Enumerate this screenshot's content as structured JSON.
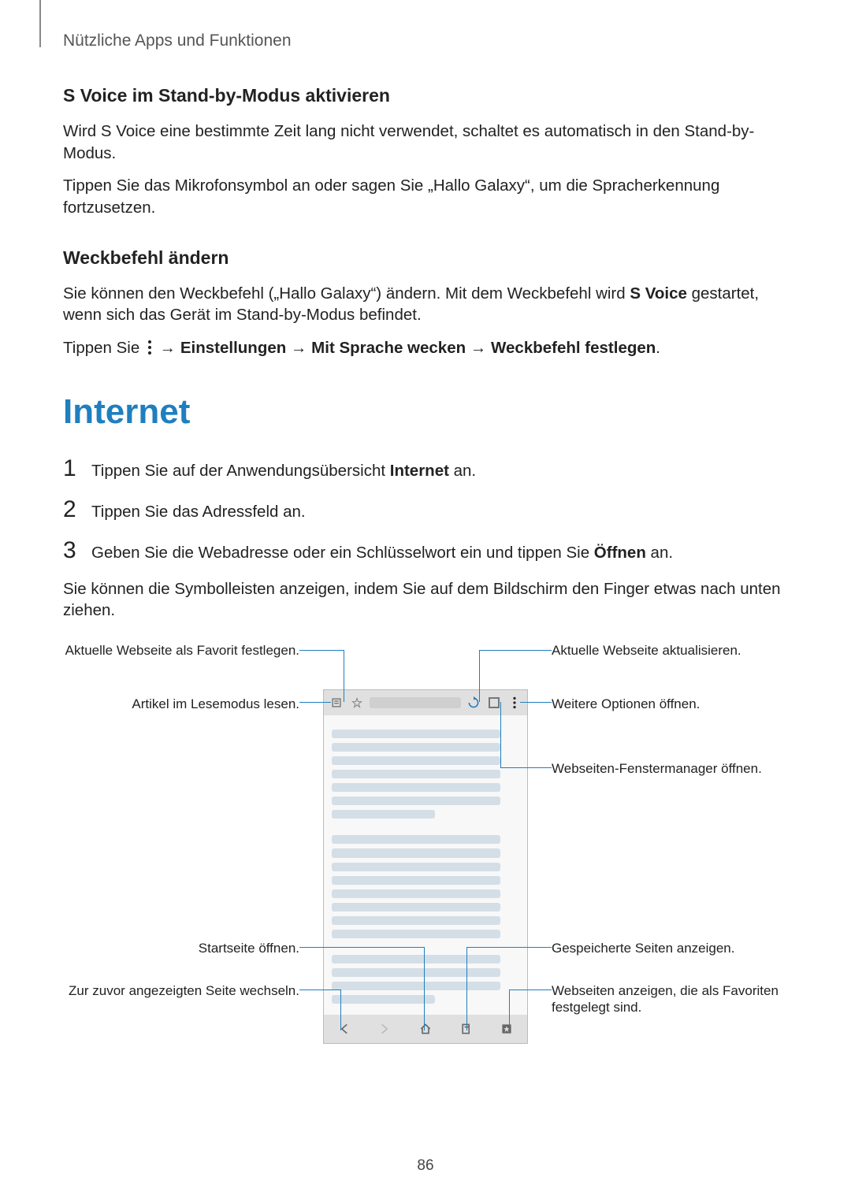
{
  "breadcrumb": "Nützliche Apps und Funktionen",
  "section1": {
    "heading": "S Voice im Stand-by-Modus aktivieren",
    "p1": "Wird S Voice eine bestimmte Zeit lang nicht verwendet, schaltet es automatisch in den Stand-by-Modus.",
    "p2": "Tippen Sie das Mikrofonsymbol an oder sagen Sie „Hallo Galaxy“, um die Spracherkennung fortzusetzen."
  },
  "section2": {
    "heading": "Weckbefehl ändern",
    "p1a": "Sie können den Weckbefehl („Hallo Galaxy“) ändern. Mit dem Weckbefehl wird ",
    "p1b_bold": "S Voice",
    "p1c": " gestartet, wenn sich das Gerät im Stand-by-Modus befindet.",
    "p2a": "Tippen Sie ",
    "p2b": " → ",
    "p2c_bold": "Einstellungen",
    "p2d": " → ",
    "p2e_bold": "Mit Sprache wecken",
    "p2f": " → ",
    "p2g_bold": "Weckbefehl festlegen",
    "p2h": "."
  },
  "title": "Internet",
  "steps": [
    {
      "num": "1",
      "a": "Tippen Sie auf der Anwendungsübersicht ",
      "bold": "Internet",
      "c": " an."
    },
    {
      "num": "2",
      "a": "Tippen Sie das Adressfeld an.",
      "bold": "",
      "c": ""
    },
    {
      "num": "3",
      "a": "Geben Sie die Webadresse oder ein Schlüsselwort ein und tippen Sie ",
      "bold": "Öffnen",
      "c": " an."
    }
  ],
  "after_steps": "Sie können die Symbolleisten anzeigen, indem Sie auf dem Bildschirm den Finger etwas nach unten ziehen.",
  "callouts": {
    "l1": "Aktuelle Webseite als Favorit festlegen.",
    "l2": "Artikel im Lesemodus lesen.",
    "l3": "Startseite öffnen.",
    "l4": "Zur zuvor angezeigten Seite wechseln.",
    "r1": "Aktuelle Webseite aktualisieren.",
    "r2": "Weitere Optionen öffnen.",
    "r3": "Webseiten-Fenstermanager öffnen.",
    "r4": "Gespeicherte Seiten anzeigen.",
    "r5": "Webseiten anzeigen, die als Favoriten festgelegt sind."
  },
  "page_number": "86"
}
